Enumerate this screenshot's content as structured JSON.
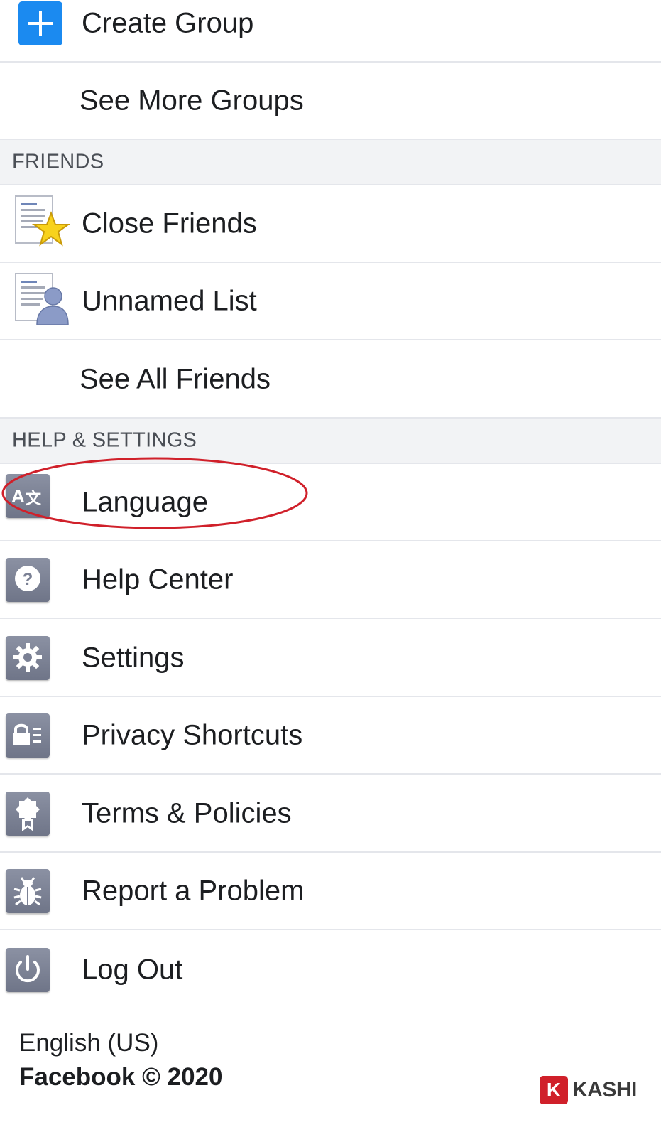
{
  "groups": {
    "create_group": "Create Group",
    "see_more": "See More Groups"
  },
  "friends": {
    "section_title": "FRIENDS",
    "items": [
      {
        "label": "Close Friends",
        "icon": "close-friends-list-icon"
      },
      {
        "label": "Unnamed List",
        "icon": "friend-list-icon"
      }
    ],
    "see_all": "See All Friends"
  },
  "help_settings": {
    "section_title": "HELP & SETTINGS",
    "items": [
      {
        "label": "Language",
        "icon": "language-icon"
      },
      {
        "label": "Help Center",
        "icon": "question-icon"
      },
      {
        "label": "Settings",
        "icon": "gear-icon"
      },
      {
        "label": "Privacy Shortcuts",
        "icon": "lock-icon"
      },
      {
        "label": "Terms & Policies",
        "icon": "ribbon-badge-icon"
      },
      {
        "label": "Report a Problem",
        "icon": "bug-icon"
      },
      {
        "label": "Log Out",
        "icon": "power-icon"
      }
    ]
  },
  "footer": {
    "language": "English (US)",
    "copyright": "Facebook © 2020"
  },
  "watermark": {
    "letter": "K",
    "name": "KASHI"
  },
  "colors": {
    "accent_blue": "#1b8af0",
    "icon_gray": "#7a8094",
    "section_bg": "#f2f3f5",
    "annotation_red": "#d0202a"
  }
}
